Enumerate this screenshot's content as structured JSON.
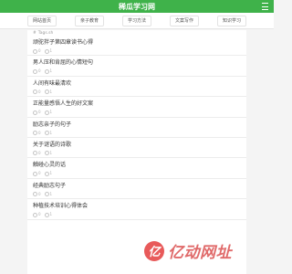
{
  "header": {
    "title": "稀瓜学习网"
  },
  "nav": {
    "items": [
      "网站首页",
      "亲子教育",
      "学习方法",
      "文案写作",
      "知识学习"
    ]
  },
  "breadcrumb": {
    "label": "Tags.sh"
  },
  "list": [
    {
      "title": "顽驼拌子第四章读书心得",
      "views": "0",
      "comments": "1"
    },
    {
      "title": "男人压和肯屈的心情短句",
      "views": "0",
      "comments": "1"
    },
    {
      "title": "人间有味最清欢",
      "views": "0",
      "comments": "1"
    },
    {
      "title": "正能量感悟人生的好文案",
      "views": "0",
      "comments": "1"
    },
    {
      "title": "励志亲子的句子",
      "views": "0",
      "comments": "1"
    },
    {
      "title": "关于谜语的诗歌",
      "views": "0",
      "comments": "1"
    },
    {
      "title": "触碰心灵的话",
      "views": "0",
      "comments": "1"
    },
    {
      "title": "经典励志句子",
      "views": "0",
      "comments": "1"
    },
    {
      "title": "种植技术培训心得体会",
      "views": "0",
      "comments": "1"
    }
  ],
  "watermark": {
    "logo_text": "亿",
    "text": "亿动网址"
  },
  "colors": {
    "header_bg": "#3fb24a",
    "watermark": "#e06a6a"
  }
}
